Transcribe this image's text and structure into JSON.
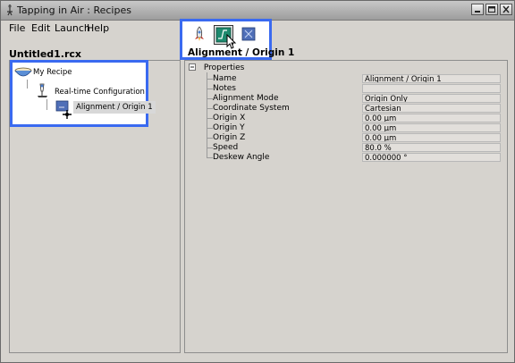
{
  "window": {
    "title": "Tapping in Air : Recipes"
  },
  "menu": {
    "items": [
      "File",
      "Edit",
      "Launch",
      "Help"
    ]
  },
  "file": {
    "name": "Untitled1.rcx"
  },
  "toolbar": {
    "caption": "Alignment / Origin 1",
    "buttons": [
      "rocket-icon",
      "alignment-icon",
      "recipe-icon"
    ]
  },
  "tree": {
    "root": "My Recipe",
    "child": "Real-time Configuration",
    "leaf": "Alignment / Origin 1"
  },
  "properties": {
    "header": "Properties",
    "rows": [
      {
        "name": "Name",
        "value": "Alignment / Origin 1"
      },
      {
        "name": "Notes",
        "value": ""
      },
      {
        "name": "Alignment Mode",
        "value": "Origin Only"
      },
      {
        "name": "Coordinate System",
        "value": "Cartesian"
      },
      {
        "name": "Origin X",
        "value": "0.00 µm"
      },
      {
        "name": "Origin Y",
        "value": "0.00 µm"
      },
      {
        "name": "Origin Z",
        "value": "0.00 µm"
      },
      {
        "name": "Speed",
        "value": "80.0 %"
      },
      {
        "name": "Deskew Angle",
        "value": "0.000000 °"
      }
    ]
  },
  "colors": {
    "highlight_border": "#3a6af0",
    "window_bg": "#d6d3ce"
  }
}
